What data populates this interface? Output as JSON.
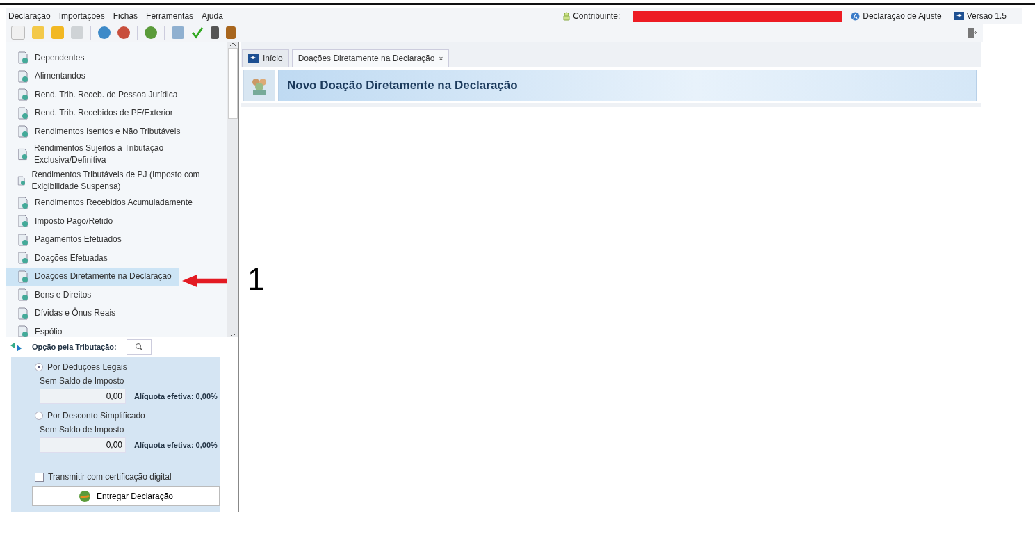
{
  "menu": [
    "Declaração",
    "Importações",
    "Fichas",
    "Ferramentas",
    "Ajuda"
  ],
  "header": {
    "contributor_label": "Contribuinte:",
    "declaration_type": "Declaração de Ajuste",
    "version": "Versão 1.5"
  },
  "sidebar": {
    "items": [
      {
        "label": "Dependentes",
        "selected": false
      },
      {
        "label": "Alimentandos",
        "selected": false
      },
      {
        "label": "Rend. Trib. Receb. de Pessoa Jurídica",
        "selected": false
      },
      {
        "label": "Rend. Trib. Recebidos de PF/Exterior",
        "selected": false
      },
      {
        "label": "Rendimentos Isentos e Não Tributáveis",
        "selected": false
      },
      {
        "label": "Rendimentos Sujeitos à Tributação Exclusiva/Definitiva",
        "selected": false
      },
      {
        "label": "Rendimentos Tributáveis de PJ (Imposto com Exigibilidade Suspensa)",
        "selected": false
      },
      {
        "label": "Rendimentos Recebidos Acumuladamente",
        "selected": false
      },
      {
        "label": "Imposto Pago/Retido",
        "selected": false
      },
      {
        "label": "Pagamentos Efetuados",
        "selected": false
      },
      {
        "label": "Doações Efetuadas",
        "selected": false
      },
      {
        "label": "Doações Diretamente na Declaração",
        "selected": true
      },
      {
        "label": "Bens e Direitos",
        "selected": false
      },
      {
        "label": "Dívidas e Ônus Reais",
        "selected": false
      },
      {
        "label": "Espólio",
        "selected": false
      }
    ]
  },
  "tax_option": {
    "title": "Opção pela Tributação:",
    "options": [
      {
        "label": "Por Deduções Legais",
        "selected": true,
        "status": "Sem Saldo de Imposto",
        "value": "0,00",
        "rate": "Alíquota efetiva: 0,00%"
      },
      {
        "label": "Por Desconto Simplificado",
        "selected": false,
        "status": "Sem Saldo de Imposto",
        "value": "0,00",
        "rate": "Alíquota efetiva: 0,00%"
      }
    ],
    "certificate": {
      "label": "Transmitir com certificação digital",
      "checked": false
    },
    "submit": "Entregar Declaração"
  },
  "tabs": [
    {
      "label": "Início",
      "selected": false,
      "closable": false
    },
    {
      "label": "Doações Diretamente na Declaração",
      "selected": true,
      "closable": true,
      "close": "×"
    }
  ],
  "page_title": "Novo Doação Diretamente na Declaração",
  "annotation": "1"
}
